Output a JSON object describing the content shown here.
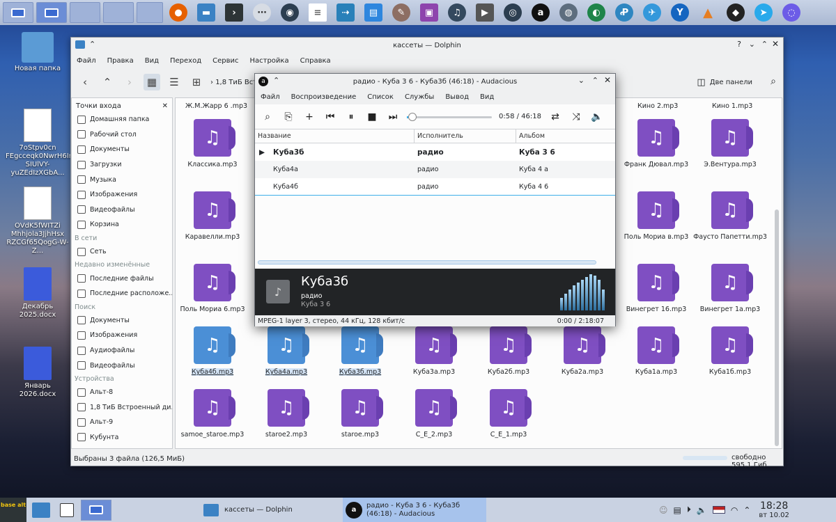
{
  "desktop": {
    "icons": [
      {
        "label": "Новая папка"
      },
      {
        "label": "7oStpv0cn FEgcceqk0NwrH6Ir SIUlVY-yuZEdIzXGbA..."
      },
      {
        "label": "OVdK5fWITZi Mhhjola3JjhHsx RZCGf65QogG-W-Z..."
      },
      {
        "label": "Декабрь 2025.docx"
      },
      {
        "label": "Январь 2026.docx"
      }
    ]
  },
  "dolphin": {
    "title": "кассеты — Dolphin",
    "menu": [
      "Файл",
      "Правка",
      "Вид",
      "Переход",
      "Сервис",
      "Настройка",
      "Справка"
    ],
    "breadcrumb": "1,8 ТиБ Встрое",
    "split_label": "Две панели",
    "places_title": "Точки входа",
    "places": [
      {
        "type": "item",
        "label": "Домашняя папка"
      },
      {
        "type": "item",
        "label": "Рабочий стол"
      },
      {
        "type": "item",
        "label": "Документы"
      },
      {
        "type": "item",
        "label": "Загрузки"
      },
      {
        "type": "item",
        "label": "Музыка"
      },
      {
        "type": "item",
        "label": "Изображения"
      },
      {
        "type": "item",
        "label": "Видеофайлы"
      },
      {
        "type": "item",
        "label": "Корзина"
      },
      {
        "type": "head",
        "label": "В сети"
      },
      {
        "type": "item",
        "label": "Сеть"
      },
      {
        "type": "head",
        "label": "Недавно изменённые"
      },
      {
        "type": "item",
        "label": "Последние файлы"
      },
      {
        "type": "item",
        "label": "Последние расположе..."
      },
      {
        "type": "head",
        "label": "Поиск"
      },
      {
        "type": "item",
        "label": "Документы"
      },
      {
        "type": "item",
        "label": "Изображения"
      },
      {
        "type": "item",
        "label": "Аудиофайлы"
      },
      {
        "type": "item",
        "label": "Видеофайлы"
      },
      {
        "type": "head",
        "label": "Устройства"
      },
      {
        "type": "item",
        "label": "Альт-8"
      },
      {
        "type": "item",
        "label": "1,8 ТиБ Встроенный ди..."
      },
      {
        "type": "item",
        "label": "Альт-9"
      },
      {
        "type": "item",
        "label": "Кубунта"
      }
    ],
    "files_top": [
      "Ж.М.Жарр 6 .mp3",
      "Кино 2.mp3",
      "Кино 1.mp3"
    ],
    "files": [
      {
        "name": "Классика.mp3",
        "sel": false
      },
      {
        "name": "Франк Дювал.mp3",
        "sel": false
      },
      {
        "name": "Э.Вентура.mp3",
        "sel": false
      },
      {
        "name": "Каравелли.mp3",
        "sel": false
      },
      {
        "name": "Поль Мориа в.mp3",
        "sel": false
      },
      {
        "name": "Фаусто Папетти.mp3",
        "sel": false
      },
      {
        "name": "Поль Мориа 6.mp3",
        "sel": false
      },
      {
        "name": "Винегрет 16.mp3",
        "sel": false
      },
      {
        "name": "Винегрет 1а.mp3",
        "sel": false
      },
      {
        "name": "Куба4б.mp3",
        "sel": true
      },
      {
        "name": "Куба4а.mp3",
        "sel": true
      },
      {
        "name": "Куба3б.mp3",
        "sel": true
      },
      {
        "name": "Куба3а.mp3",
        "sel": false
      },
      {
        "name": "Куба2б.mp3",
        "sel": false
      },
      {
        "name": "Куба2а.mp3",
        "sel": false
      },
      {
        "name": "Куба1а.mp3",
        "sel": false
      },
      {
        "name": "Куба1б.mp3",
        "sel": false
      },
      {
        "name": "samoe_staroe.mp3",
        "sel": false
      },
      {
        "name": "staroe2.mp3",
        "sel": false
      },
      {
        "name": "staroe.mp3",
        "sel": false
      },
      {
        "name": "C_E_2.mp3",
        "sel": false
      },
      {
        "name": "C_E_1.mp3",
        "sel": false
      }
    ],
    "status": "Выбраны 3 файла (126,5 МиБ)",
    "free": "свободно 595,1 Гиб"
  },
  "audacious": {
    "title": "радио - Куба 3 6 - Куба3б (46:18) - Audacious",
    "menu": [
      "Файл",
      "Воспроизведение",
      "Список",
      "Службы",
      "Вывод",
      "Вид"
    ],
    "time": "0:58 / 46:18",
    "progress": 0.02,
    "columns": [
      "Название",
      "Исполнитель",
      "Альбом"
    ],
    "rows": [
      {
        "title": "Куба3б",
        "artist": "радио",
        "album": "Куба 3 6",
        "playing": true
      },
      {
        "title": "Куба4а",
        "artist": "радио",
        "album": "Куба 4 а",
        "playing": false
      },
      {
        "title": "Куба4б",
        "artist": "радио",
        "album": "Куба 4 6",
        "playing": false
      }
    ],
    "now_title": "Куба3б",
    "now_artist": "радио",
    "now_album": "Куба 3 6",
    "codec": "MPEG-1 layer 3, стерео, 44 кГц, 128 кбит/с",
    "total": "0:00 / 2:18:07"
  },
  "taskbar": {
    "logo": "base alt",
    "task1": "кассеты — Dolphin",
    "task2": "радио - Куба 3 6 - Куба3б (46:18) - Audacious",
    "time": "18:28",
    "date": "вт 10.02"
  },
  "colors": {
    "accent": "#3daee9",
    "file_icon": "#7f4fc2",
    "selected_icon": "#4b8fd6"
  }
}
